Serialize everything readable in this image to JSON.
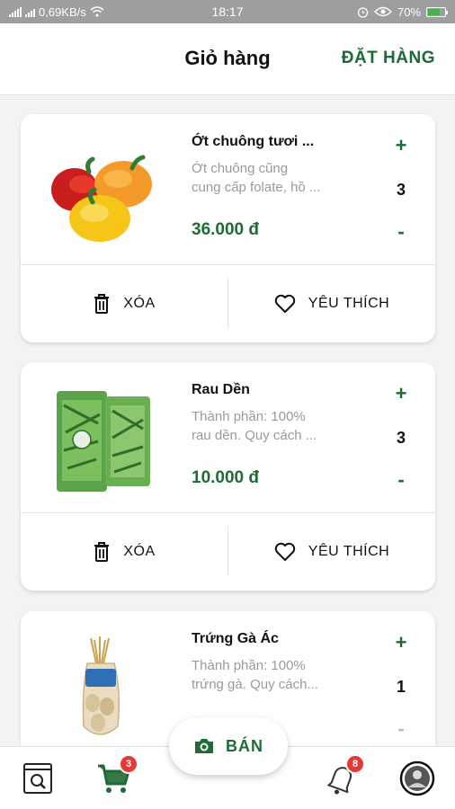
{
  "status_bar": {
    "network_speed": "0,69KB/s",
    "time": "18:17",
    "battery": "70%",
    "battery_level": 0.7
  },
  "header": {
    "title": "Giỏ hàng",
    "order_button": "ĐẶT HÀNG"
  },
  "cart": {
    "items": [
      {
        "name": "Ớt chuông tươi ...",
        "desc_line1": "Ớt chuông cũng",
        "desc_line2": "cung cấp folate, hồ ...",
        "price": "36.000 đ",
        "quantity": "3",
        "plus": "+",
        "minus": "-",
        "remove": "XÓA",
        "favorite": "YÊU THÍCH",
        "image": "bell-peppers"
      },
      {
        "name": "Rau Dền",
        "desc_line1": "Thành phần: 100%",
        "desc_line2": "rau dền.  Quy cách ...",
        "price": "10.000 đ",
        "quantity": "3",
        "plus": "+",
        "minus": "-",
        "remove": "XÓA",
        "favorite": "YÊU THÍCH",
        "image": "amaranth-pack"
      },
      {
        "name": "Trứng Gà Ác",
        "desc_line1": "Thành phần: 100%",
        "desc_line2": "trứng gà.  Quy cách...",
        "price": "",
        "quantity": "1",
        "plus": "+",
        "minus": "-",
        "remove": "",
        "favorite": "",
        "image": "egg-bag"
      }
    ]
  },
  "tab_bar": {
    "sell_label": "BÁN",
    "cart_badge": "3",
    "notification_badge": "8",
    "icons": [
      "search-document-icon",
      "cart-icon",
      "camera-icon",
      "bell-icon",
      "avatar"
    ]
  },
  "colors": {
    "brand_green": "#1e6b34",
    "badge_red": "#e53935"
  }
}
